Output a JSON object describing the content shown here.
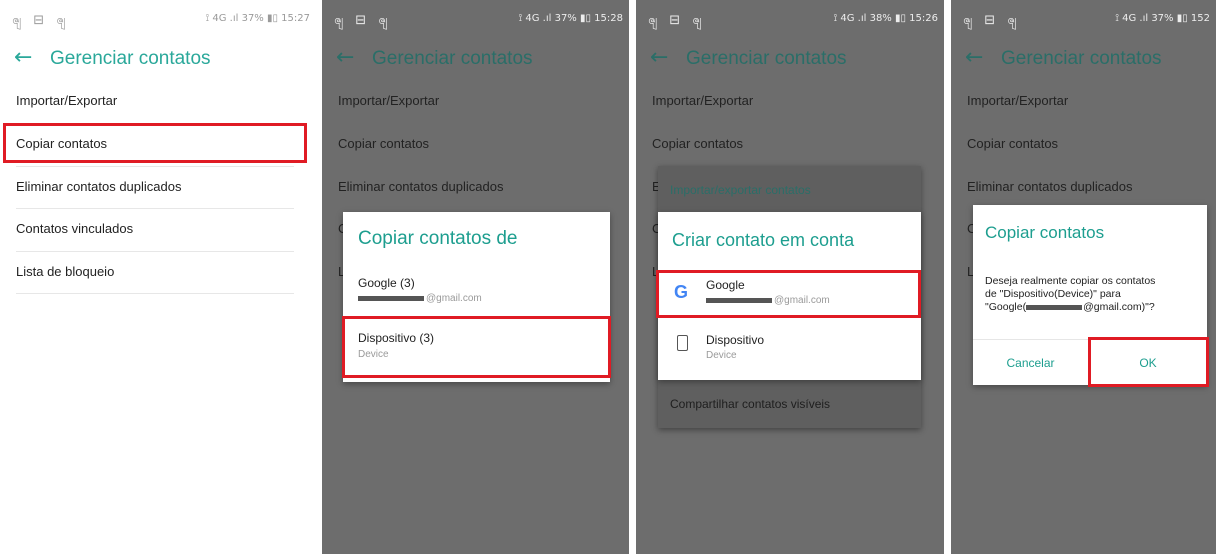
{
  "status": {
    "left_icons": "ၛ ⊟ ၛ",
    "p1_right": "⟟ 4G .ıl 37% ▮▯ 15:27",
    "p2_right": "⟟ 4G .ıl 37% ▮▯ 15:28",
    "p3_right": "⟟ 4G .ıl 38% ▮▯ 15:26",
    "p4_right": "⟟ 4G .ıl 37% ▮▯ 152"
  },
  "header": {
    "back_icon": "←",
    "title": "Gerenciar contatos"
  },
  "menu": {
    "import_export": "Importar/Exportar",
    "copy_contacts": "Copiar contatos",
    "delete_duplicates": "Eliminar contatos duplicados",
    "linked_contacts": "Contatos vinculados",
    "block_list": "Lista de bloqueio"
  },
  "partial_letters": {
    "c": "C",
    "l": "L",
    "e": "E"
  },
  "dialog_copy_from": {
    "title": "Copiar contatos de",
    "google_label": "Google  (3)",
    "google_email_suffix": "@gmail.com",
    "device_label": "Dispositivo  (3)",
    "device_sub": "Device"
  },
  "background_menu": {
    "import_export_contacts": "Importar/exportar contatos",
    "share_visible": "Compartilhar contatos visíveis"
  },
  "dialog_create_in_account": {
    "title": "Criar contato em conta",
    "google_icon": "G",
    "google_label": "Google",
    "google_email_suffix": "@gmail.com",
    "device_label": "Dispositivo",
    "device_sub": "Device"
  },
  "dialog_confirm": {
    "title": "Copiar contatos",
    "message_line1": "Deseja realmente copiar os contatos",
    "message_line2": "de \"Dispositivo(Device)\" para",
    "message_line3_prefix": "\"Google(",
    "message_line3_suffix": "@gmail.com)\"?",
    "cancel": "Cancelar",
    "ok": "OK"
  },
  "colors": {
    "accent": "#1d9e8f",
    "highlight_border": "#e01b24",
    "dim_overlay": "#6d6d6d"
  }
}
